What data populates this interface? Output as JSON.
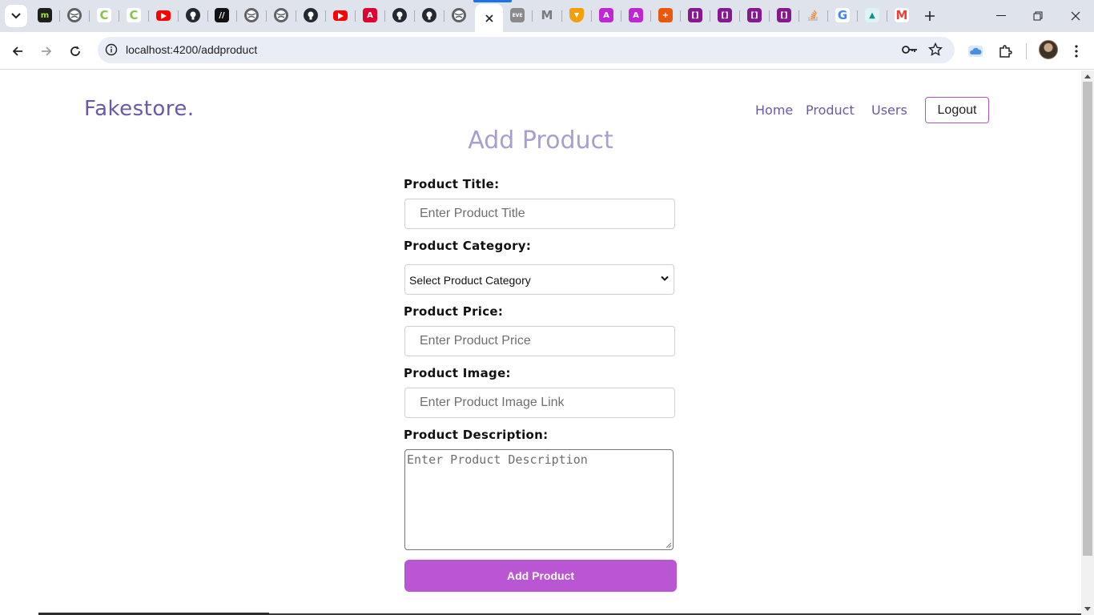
{
  "browser": {
    "tabs": [
      {
        "icon": "medium-icon",
        "color": "#1e1e1e",
        "glyph": "m",
        "glyph_color": "#a3e635"
      },
      {
        "icon": "globe-icon",
        "color": "#5f6368",
        "glyph": "",
        "glyph_color": "#ffffff"
      },
      {
        "icon": "c-logo-icon",
        "color": "#ffffff",
        "glyph": "C",
        "glyph_color": "#8bc34a"
      },
      {
        "icon": "c-logo-icon",
        "color": "#ffffff",
        "glyph": "C",
        "glyph_color": "#8bc34a"
      },
      {
        "icon": "youtube-icon",
        "color": "#ff0000",
        "glyph": "",
        "glyph_color": "#ffffff"
      },
      {
        "icon": "github-icon",
        "color": "#24292f",
        "glyph": "",
        "glyph_color": "#ffffff"
      },
      {
        "icon": "slash-logo-icon",
        "color": "#111111",
        "glyph": "//",
        "glyph_color": "#ffffff"
      },
      {
        "icon": "globe-icon",
        "color": "#5f6368",
        "glyph": "",
        "glyph_color": "#ffffff"
      },
      {
        "icon": "globe-icon",
        "color": "#5f6368",
        "glyph": "",
        "glyph_color": "#ffffff"
      },
      {
        "icon": "github-icon",
        "color": "#24292f",
        "glyph": "",
        "glyph_color": "#ffffff"
      },
      {
        "icon": "youtube-icon",
        "color": "#ff0000",
        "glyph": "",
        "glyph_color": "#ffffff"
      },
      {
        "icon": "angular-icon",
        "color": "#dd0031",
        "glyph": "A",
        "glyph_color": "#ffffff"
      },
      {
        "icon": "github-icon",
        "color": "#24292f",
        "glyph": "",
        "glyph_color": "#ffffff"
      },
      {
        "icon": "github-icon",
        "color": "#24292f",
        "glyph": "",
        "glyph_color": "#ffffff"
      },
      {
        "icon": "globe-icon",
        "color": "#5f6368",
        "glyph": "",
        "glyph_color": "#ffffff"
      },
      {
        "icon": "eve-icon",
        "color": "#8a8a8a",
        "glyph": "EVE",
        "glyph_color": "#ffffff"
      },
      {
        "icon": "m-logo-icon",
        "color": "#dfe3eb",
        "glyph": "M",
        "glyph_color": "#7a7a7a"
      },
      {
        "icon": "brave-icon",
        "color": "#f59e0b",
        "glyph": "",
        "glyph_color": "#ffffff"
      },
      {
        "icon": "angular-icon",
        "color": "#c026d3",
        "glyph": "A",
        "glyph_color": "#ffffff"
      },
      {
        "icon": "angular-icon",
        "color": "#c026d3",
        "glyph": "A",
        "glyph_color": "#ffffff"
      },
      {
        "icon": "plugin-icon",
        "color": "#ea580c",
        "glyph": "+",
        "glyph_color": "#ffffff"
      },
      {
        "icon": "bracket-icon",
        "color": "#86198f",
        "glyph": "[]",
        "glyph_color": "#ffffff"
      },
      {
        "icon": "bracket-icon",
        "color": "#86198f",
        "glyph": "[]",
        "glyph_color": "#ffffff"
      },
      {
        "icon": "bracket-icon",
        "color": "#86198f",
        "glyph": "[]",
        "glyph_color": "#ffffff"
      },
      {
        "icon": "bracket-icon",
        "color": "#86198f",
        "glyph": "[]",
        "glyph_color": "#ffffff"
      },
      {
        "icon": "stackoverflow-icon",
        "color": "#dfe3eb",
        "glyph": "",
        "glyph_color": "#f48024"
      },
      {
        "icon": "google-icon",
        "color": "#ffffff",
        "glyph": "G",
        "glyph_color": "#4285f4"
      },
      {
        "icon": "mountain-icon",
        "color": "#e0f2f1",
        "glyph": "▲",
        "glyph_color": "#0d9488"
      },
      {
        "icon": "gmail-icon",
        "color": "#ffffff",
        "glyph": "M",
        "glyph_color": "#ea4335"
      }
    ],
    "url": "localhost:4200/addproduct"
  },
  "navbar": {
    "brand": "Fakestore.",
    "links": [
      "Home",
      "Product",
      "Users"
    ],
    "logout_label": "Logout"
  },
  "page": {
    "title": "Add Product"
  },
  "form": {
    "title_label": "Product Title:",
    "title_placeholder": "Enter Product Title",
    "category_label": "Product Category:",
    "category_selected": "Select Product Category",
    "price_label": "Product Price:",
    "price_placeholder": "Enter Product Price",
    "image_label": "Product Image:",
    "image_placeholder": "Enter Product Image Link",
    "description_label": "Product Description:",
    "description_placeholder": "Enter Product Description",
    "submit_label": "Add Product"
  },
  "colors": {
    "brand": "#6a58a8",
    "title": "#a89ed1",
    "accent": "#ba55d3"
  }
}
